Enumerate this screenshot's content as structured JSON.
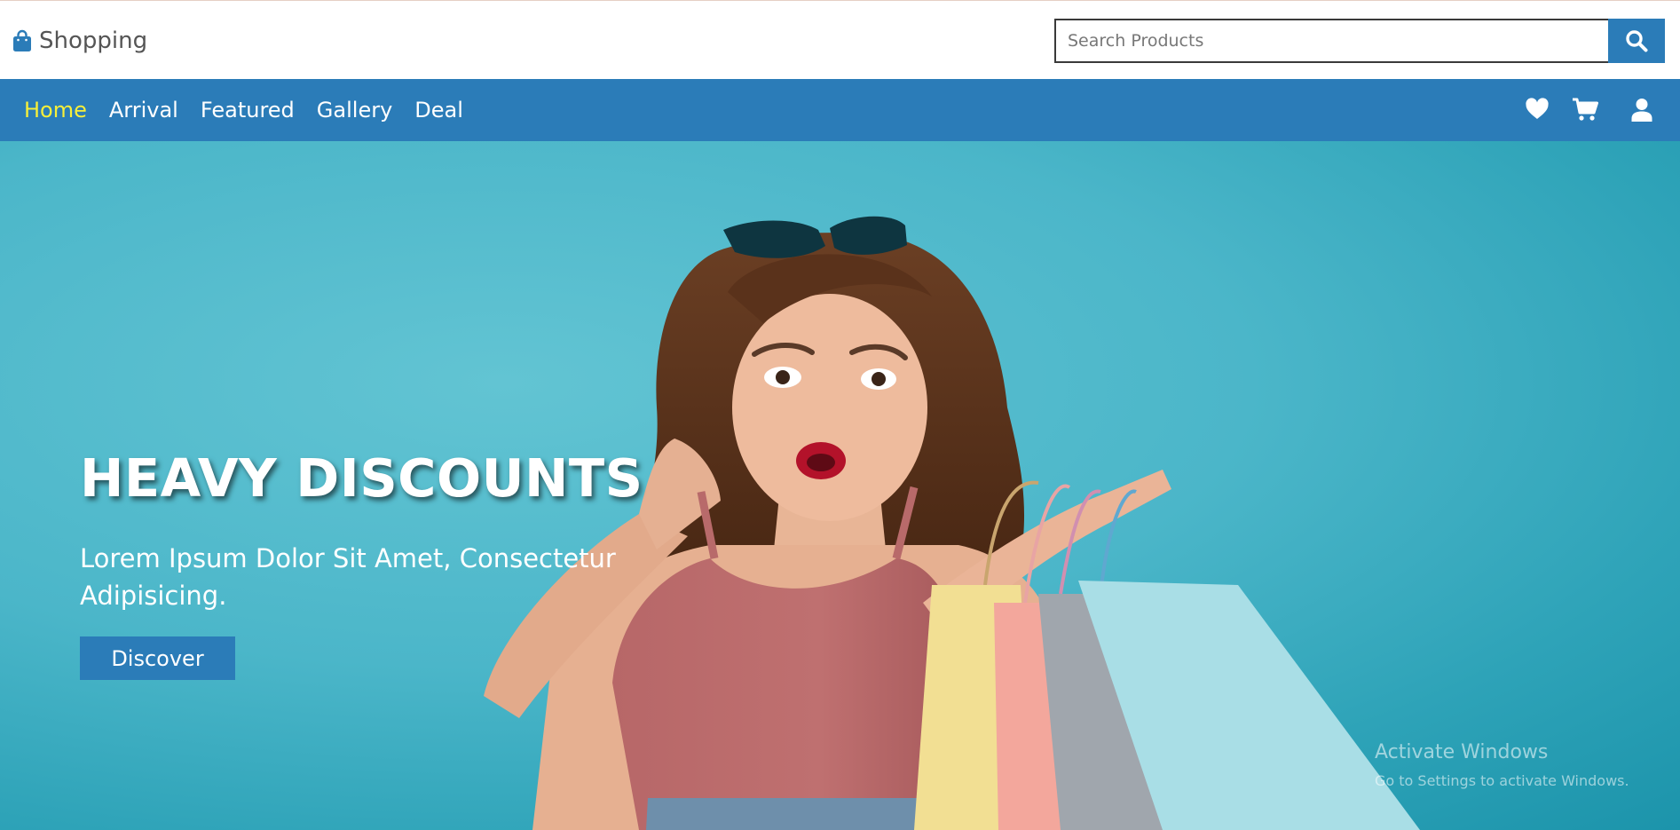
{
  "colors": {
    "primary": "#2b7cb8",
    "active_nav": "#f7ef3a",
    "hero_background": "#4bb6c9",
    "text_gray": "#555555"
  },
  "header": {
    "brand_icon": "shopping-bag-icon",
    "brand_name": "Shopping",
    "search": {
      "placeholder": "Search Products",
      "value": "",
      "button_icon": "search-icon"
    }
  },
  "nav": {
    "links": [
      {
        "label": "Home",
        "active": true
      },
      {
        "label": "Arrival",
        "active": false
      },
      {
        "label": "Featured",
        "active": false
      },
      {
        "label": "Gallery",
        "active": false
      },
      {
        "label": "Deal",
        "active": false
      }
    ],
    "icons": [
      "heart-icon",
      "cart-icon",
      "user-icon"
    ]
  },
  "hero": {
    "title": "HEAVY DISCOUNTS",
    "subtitle": "Lorem Ipsum Dolor Sit Amet, Consectetur Adipisicing.",
    "cta_label": "Discover",
    "image": "woman-holding-shopping-bags"
  },
  "os_watermark": {
    "title": "Activate Windows",
    "subtitle": "Go to Settings to activate Windows."
  }
}
